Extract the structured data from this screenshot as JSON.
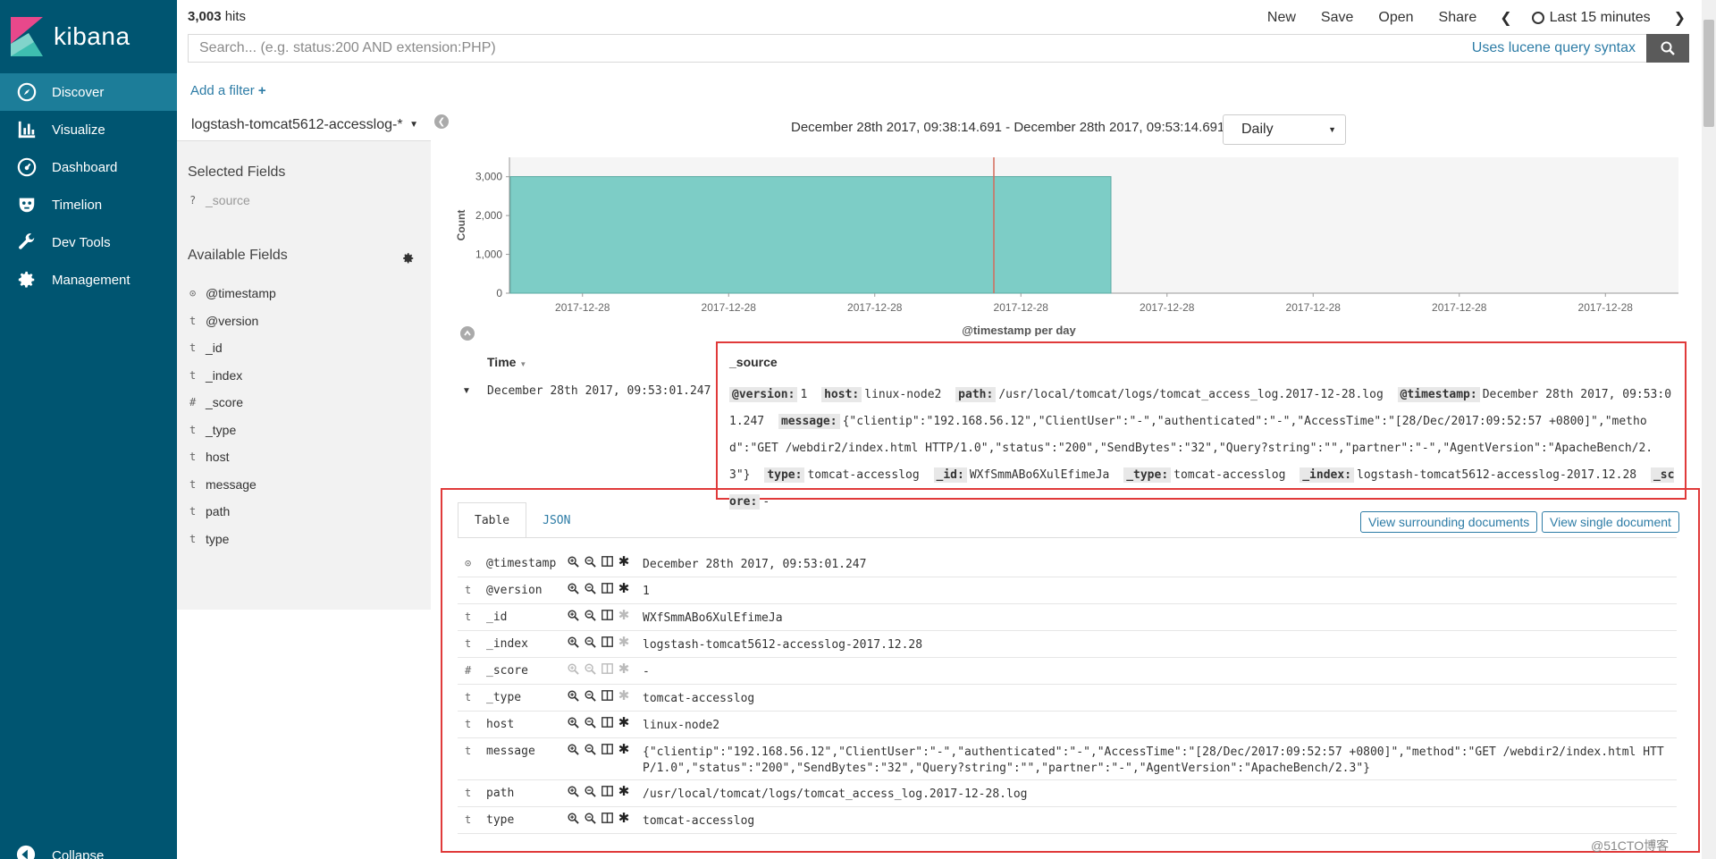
{
  "app": {
    "brand": "kibana",
    "hits_count": "3,003",
    "hits_label": "hits",
    "watermark": "@51CTO博客"
  },
  "sidebar": {
    "items": [
      {
        "label": "Discover",
        "icon": "compass-icon",
        "active": true
      },
      {
        "label": "Visualize",
        "icon": "bar-chart-icon",
        "active": false
      },
      {
        "label": "Dashboard",
        "icon": "dashboard-gauge-icon",
        "active": false
      },
      {
        "label": "Timelion",
        "icon": "timelion-mask-icon",
        "active": false
      },
      {
        "label": "Dev Tools",
        "icon": "wrench-icon",
        "active": false
      },
      {
        "label": "Management",
        "icon": "gear-icon",
        "active": false
      }
    ],
    "collapse_label": "Collapse"
  },
  "topbar": {
    "menu": [
      "New",
      "Save",
      "Open",
      "Share"
    ],
    "time_range": "Last 15 minutes",
    "search_placeholder": "Search... (e.g. status:200 AND extension:PHP)",
    "lucene_link": "Uses lucene query syntax",
    "add_filter": "Add a filter"
  },
  "fields_panel": {
    "index_pattern": "logstash-tomcat5612-accesslog-*",
    "selected_title": "Selected Fields",
    "selected_fields": [
      {
        "type": "?",
        "name": "_source"
      }
    ],
    "available_title": "Available Fields",
    "available_fields": [
      {
        "type": "clock",
        "name": "@timestamp"
      },
      {
        "type": "t",
        "name": "@version"
      },
      {
        "type": "t",
        "name": "_id"
      },
      {
        "type": "t",
        "name": "_index"
      },
      {
        "type": "#",
        "name": "_score"
      },
      {
        "type": "t",
        "name": "_type"
      },
      {
        "type": "t",
        "name": "host"
      },
      {
        "type": "t",
        "name": "message"
      },
      {
        "type": "t",
        "name": "path"
      },
      {
        "type": "t",
        "name": "type"
      }
    ]
  },
  "histogram": {
    "range_text": "December 28th 2017, 09:38:14.691 - December 28th 2017, 09:53:14.691 —",
    "interval": "Daily"
  },
  "chart_data": {
    "type": "bar",
    "ylabel": "Count",
    "xlabel": "@timestamp per day",
    "ylim": [
      0,
      3500
    ],
    "yticks": [
      0,
      1000,
      2000,
      3000
    ],
    "ytick_labels": [
      "0",
      "1,000",
      "2,000",
      "3,000"
    ],
    "xtick_labels": [
      "2017-12-28",
      "2017-12-28",
      "2017-12-28",
      "2017-12-28",
      "2017-12-28",
      "2017-12-28",
      "2017-12-28",
      "2017-12-28"
    ],
    "categories": [
      "2017-12-28"
    ],
    "values": [
      3003
    ],
    "colors": {
      "bar": "#7dcdc6",
      "bar_stroke": "#5aa9a2",
      "now_line": "#d36b5b",
      "plot_bg": "#f5f5f5"
    }
  },
  "doc_table": {
    "header_time": "Time",
    "header_source": "_source",
    "row_time": "December 28th 2017, 09:53:01.247",
    "source_pairs": [
      {
        "k": "@version:",
        "v": "1"
      },
      {
        "k": "host:",
        "v": "linux-node2"
      },
      {
        "k": "path:",
        "v": "/usr/local/tomcat/logs/tomcat_access_log.2017-12-28.log"
      },
      {
        "k": "@timestamp:",
        "v": "December 28th 2017, 09:53:01.247"
      },
      {
        "k": "message:",
        "v": "{\"clientip\":\"192.168.56.12\",\"ClientUser\":\"-\",\"authenticated\":\"-\",\"AccessTime\":\"[28/Dec/2017:09:52:57 +0800]\",\"method\":\"GET /webdir2/index.html HTTP/1.0\",\"status\":\"200\",\"SendBytes\":\"32\",\"Query?string\":\"\",\"partner\":\"-\",\"AgentVersion\":\"ApacheBench/2.3\"}"
      },
      {
        "k": "type:",
        "v": "tomcat-accesslog"
      },
      {
        "k": "_id:",
        "v": "WXfSmmABo6XulEfimeJa"
      },
      {
        "k": "_type:",
        "v": "tomcat-accesslog"
      },
      {
        "k": "_index:",
        "v": "logstash-tomcat5612-accesslog-2017.12.28"
      },
      {
        "k": "_score:",
        "v": "-"
      }
    ]
  },
  "doc_detail": {
    "tab_table": "Table",
    "tab_json": "JSON",
    "btn_surrounding": "View surrounding documents",
    "btn_single": "View single document",
    "rows": [
      {
        "type": "clock",
        "name": "@timestamp",
        "value": "December 28th 2017, 09:53:01.247",
        "active": true
      },
      {
        "type": "t",
        "name": "@version",
        "value": "1",
        "active": true
      },
      {
        "type": "t",
        "name": "_id",
        "value": "WXfSmmABo6XulEfimeJa",
        "active": false
      },
      {
        "type": "t",
        "name": "_index",
        "value": "logstash-tomcat5612-accesslog-2017.12.28",
        "active": false
      },
      {
        "type": "#",
        "name": "_score",
        "value": " -",
        "active": false,
        "disabled": true
      },
      {
        "type": "t",
        "name": "_type",
        "value": "tomcat-accesslog",
        "active": false
      },
      {
        "type": "t",
        "name": "host",
        "value": "linux-node2",
        "active": true
      },
      {
        "type": "t",
        "name": "message",
        "value": "{\"clientip\":\"192.168.56.12\",\"ClientUser\":\"-\",\"authenticated\":\"-\",\"AccessTime\":\"[28/Dec/2017:09:52:57 +0800]\",\"method\":\"GET /webdir2/index.html HTTP/1.0\",\"status\":\"200\",\"SendBytes\":\"32\",\"Query?string\":\"\",\"partner\":\"-\",\"AgentVersion\":\"ApacheBench/2.3\"}",
        "active": true
      },
      {
        "type": "t",
        "name": "path",
        "value": "/usr/local/tomcat/logs/tomcat_access_log.2017-12-28.log",
        "active": true
      },
      {
        "type": "t",
        "name": "type",
        "value": "tomcat-accesslog",
        "active": true
      }
    ]
  }
}
